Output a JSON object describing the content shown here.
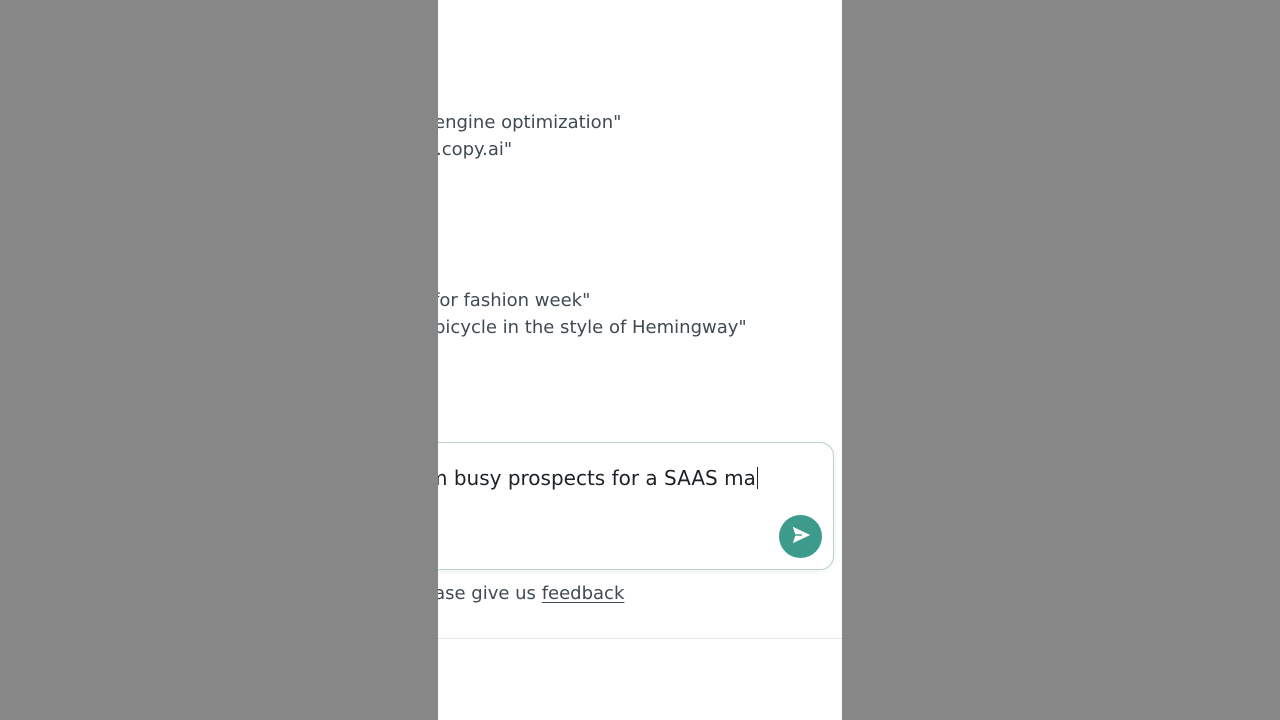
{
  "examples": [
    {
      "text": "engine optimization\""
    },
    {
      "text": ".copy.ai\""
    },
    {
      "text": "for fashion week\""
    },
    {
      "text": "bicycle in the style of Hemingway\""
    }
  ],
  "prompt": {
    "value": "m busy prospects for a SAAS ma"
  },
  "send_button": {
    "icon": "send-icon",
    "color": "#3d9b8c"
  },
  "footer": {
    "prefix": "ease give us",
    "link_label": "feedback"
  },
  "colors": {
    "background_dim": "#878787",
    "panel": "#ffffff",
    "text": "#3f4a52",
    "accent": "#3d9b8c"
  }
}
